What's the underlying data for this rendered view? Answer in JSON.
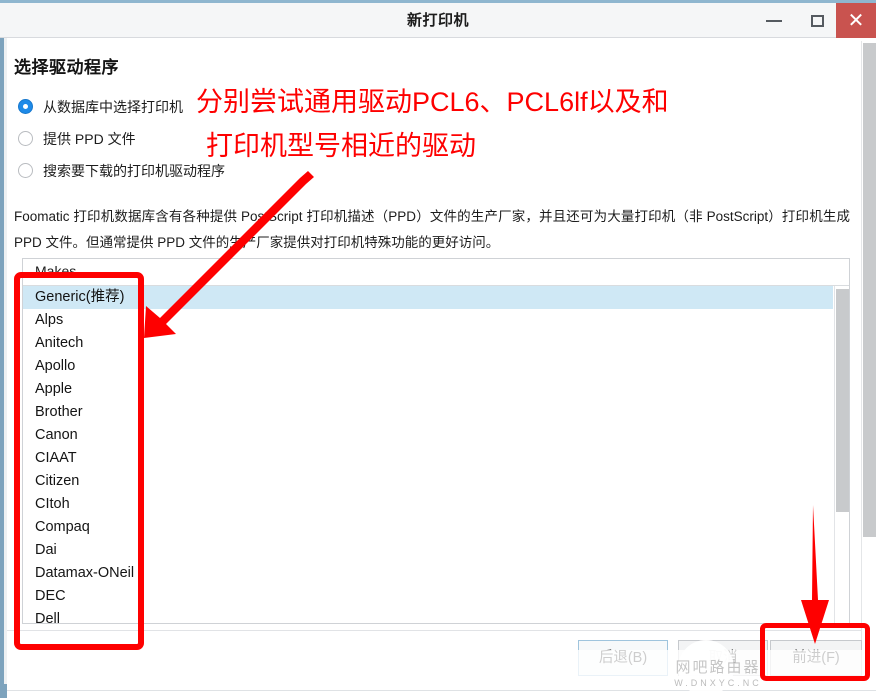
{
  "window": {
    "title": "新打印机",
    "controls": {
      "minimize": "–",
      "maximize": "□",
      "close": "✕"
    }
  },
  "content": {
    "heading": "选择驱动程序",
    "radios": [
      {
        "label": "从数据库中选择打印机",
        "selected": true
      },
      {
        "label": "提供 PPD 文件",
        "selected": false
      },
      {
        "label": "搜索要下载的打印机驱动程序",
        "selected": false
      }
    ],
    "description": "Foomatic 打印机数据库含有各种提供 PostScript 打印机描述（PPD）文件的生产厂家，并且还可为大量打印机（非 PostScript）打印机生成 PPD 文件。但通常提供 PPD 文件的生产厂家提供对打印机特殊功能的更好访问。",
    "list": {
      "header": "Makes",
      "selected_index": 0,
      "items": [
        "Generic(推荐)",
        "Alps",
        "Anitech",
        "Apollo",
        "Apple",
        "Brother",
        "Canon",
        "CIAAT",
        "Citizen",
        "CItoh",
        "Compaq",
        "Dai",
        "Datamax-ONeil",
        "DEC",
        "Dell"
      ]
    }
  },
  "footer": {
    "back_label": "后退(B)",
    "cancel_label": "取消",
    "forward_label": "前进(F)"
  },
  "annotations": {
    "note_line1": "分别尝试通用驱动PCL6、PCL6lf以及和",
    "note_line2": "打印机型号相近的驱动",
    "color": "#fe0000"
  },
  "watermark": {
    "text": "网吧路由器",
    "subtext": "W.DNXYC.NC"
  },
  "colors": {
    "titlebar_bg": "#f5f6f7",
    "close_red": "#c9534f",
    "selection_blue": "#cfe8f5",
    "radio_blue": "#1e8ae8",
    "window_edge": "#7da3bd",
    "annotation_red": "#fe0000"
  }
}
